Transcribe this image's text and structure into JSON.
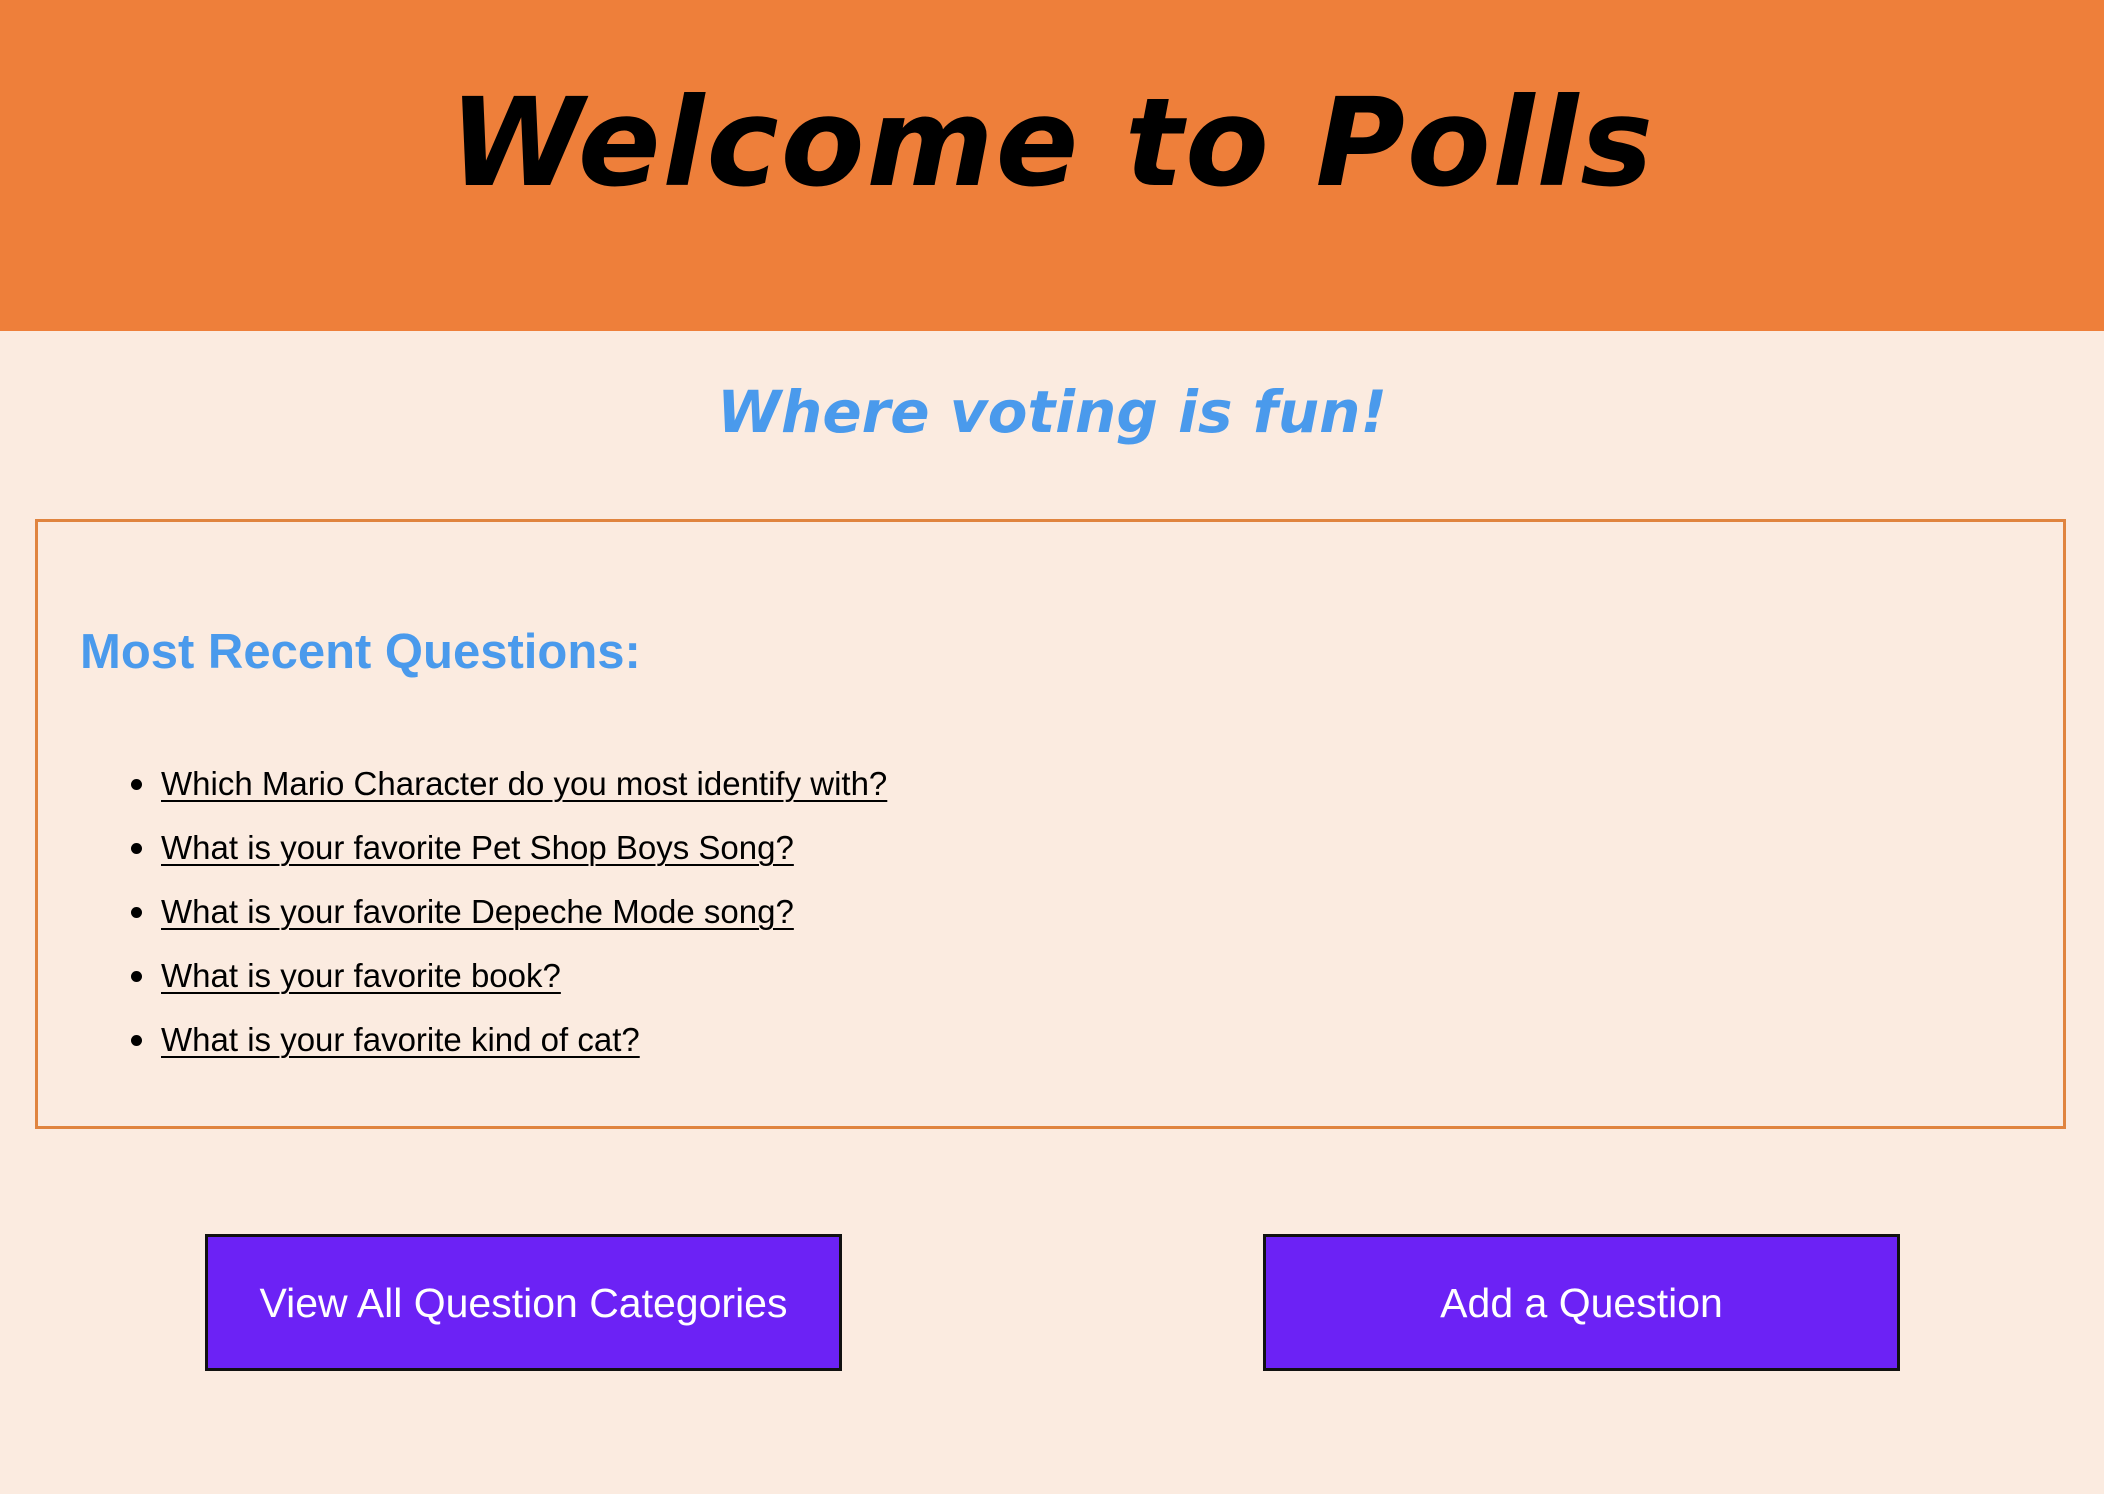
{
  "header": {
    "title": "Welcome to Polls",
    "background_color": "#ee7f3a"
  },
  "subtitle": "Where voting is fun!",
  "recent": {
    "heading": "Most Recent Questions:",
    "questions": [
      "Which Mario Character do you most identify with?",
      "What is your favorite Pet Shop Boys Song?",
      "What is your favorite Depeche Mode song?",
      "What is your favorite book?",
      "What is your favorite kind of cat?"
    ]
  },
  "buttons": {
    "categories_label": "View All Question Categories",
    "add_label": "Add a Question",
    "color": "#6c22f5"
  },
  "colors": {
    "page_background": "#fbebe0",
    "accent_blue": "#4a9aec",
    "box_border": "#e0843f"
  }
}
